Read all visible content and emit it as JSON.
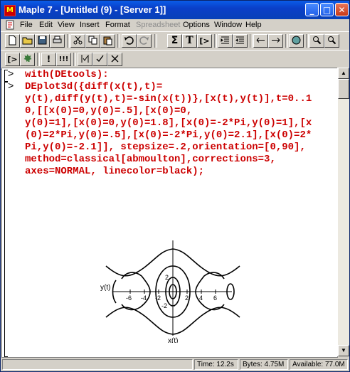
{
  "window": {
    "title": "Maple 7 - [Untitled (9) - [Server 1]]",
    "icon_label": "M"
  },
  "menu": [
    "File",
    "Edit",
    "View",
    "Insert",
    "Format",
    "Spreadsheet",
    "Options",
    "Window",
    "Help"
  ],
  "toolbar1": {
    "buttons": [
      "new",
      "open",
      "save",
      "print",
      "cut",
      "copy",
      "paste",
      "undo",
      "redo",
      "sum",
      "T",
      "[>",
      "insert-section",
      "remove-section",
      "prev",
      "next",
      "stop",
      "zoom-out",
      "zoom-in"
    ],
    "labels": {
      "sum": "Σ",
      "text": "T",
      "prompt": "[>"
    }
  },
  "toolbar2": {
    "labels": {
      "maple": "[>",
      "exclaim": "!",
      "exclaim_all": "!!!"
    }
  },
  "worksheet": {
    "prompt_mark": ">",
    "input1": "with(DEtools):",
    "input2_lines": [
      "DEplot3d({diff(x(t),t)=",
      "y(t),diff(y(t),t)=-sin(x(t))},[x(t),y(t)],t=0..1",
      "0,[[x(0)=0,y(0)=.5],[x(0)=0,",
      "y(0)=1],[x(0)=0,y(0)=1.8],[x(0)=-2*Pi,y(0)=1],[x",
      "(0)=2*Pi,y(0)=.5],[x(0)=-2*Pi,y(0)=2.1],[x(0)=2*",
      "Pi,y(0)=-2.1]], stepsize=.2,orientation=[0,90],",
      "method=classical[abmoulton],corrections=3,",
      "axes=NORMAL, linecolor=black);"
    ]
  },
  "plot": {
    "y_axis_label": "y(t)",
    "x_axis_label": "x(t)",
    "x_ticks": [
      "-6",
      "-4",
      "-2",
      "2",
      "4",
      "6"
    ],
    "y_ticks": [
      "2",
      "-2"
    ]
  },
  "status": {
    "time": "Time: 12.2s",
    "bytes": "Bytes: 4.75M",
    "available": "Available: 77.0M"
  },
  "colors": {
    "input_text": "#cc0000",
    "title_bar": "#0a4ed8"
  }
}
